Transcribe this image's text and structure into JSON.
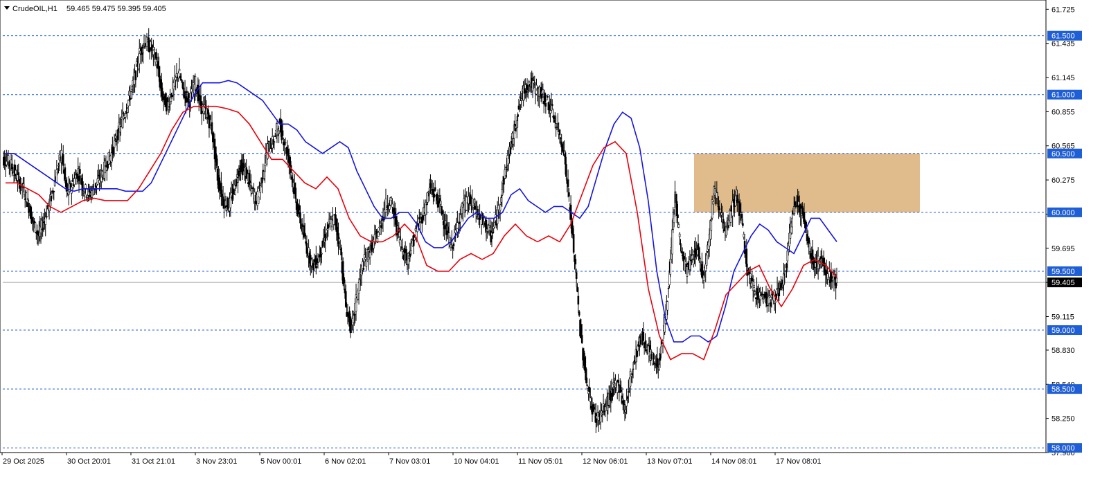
{
  "header": {
    "symbol": "CrudeOIL,H1",
    "ohlc": "59.465 59.475 59.395 59.405"
  },
  "colors": {
    "background": "#ffffff",
    "candle": "#000000",
    "level_line": "#1f5fd6",
    "level_label_bg": "#1f5fd6",
    "ma_fast": "#e8000b",
    "ma_slow": "#1414e0",
    "zone": "#deb887",
    "current_price_bg": "#000000",
    "current_price_line": "#a0a0a0"
  },
  "chart_data": {
    "type": "candlestick",
    "symbol": "CrudeOIL",
    "timeframe": "H1",
    "y_axis_ticks": [
      "61.725",
      "61.435",
      "61.145",
      "60.855",
      "60.565",
      "60.275",
      "59.985",
      "59.695",
      "59.405",
      "59.115",
      "58.830",
      "58.540",
      "58.250",
      "57.960"
    ],
    "ylim": [
      57.96,
      61.78
    ],
    "x_axis_labels": [
      "29 Oct 2025",
      "30 Oct 20:01",
      "31 Oct 21:01",
      "3 Nov 23:01",
      "5 Nov 00:01",
      "6 Nov 02:01",
      "7 Nov 03:01",
      "10 Nov 04:01",
      "11 Nov 05:01",
      "12 Nov 06:01",
      "13 Nov 07:01",
      "14 Nov 08:01",
      "17 Nov 08:01"
    ],
    "horizontal_levels": [
      "61.500",
      "61.000",
      "60.500",
      "60.000",
      "59.500",
      "59.000",
      "58.500",
      "58.000"
    ],
    "current_price": "59.405",
    "resistance_zone": {
      "low": 60.0,
      "high": 60.5,
      "from": "14 Nov 2025",
      "to": "17 Nov 2025"
    },
    "series": [
      {
        "type": "close",
        "values": [
          60.45,
          60.4,
          60.3,
          60.22,
          60.08,
          59.9,
          59.8,
          59.95,
          60.1,
          60.3,
          60.5,
          60.15,
          60.25,
          60.35,
          60.2,
          60.15,
          60.22,
          60.3,
          60.4,
          60.5,
          60.65,
          60.8,
          60.95,
          61.1,
          61.35,
          61.45,
          61.4,
          61.3,
          61.0,
          60.9,
          61.05,
          61.2,
          61.0,
          60.95,
          61.1,
          60.9,
          60.85,
          60.7,
          60.3,
          60.1,
          60.05,
          60.2,
          60.4,
          60.35,
          60.2,
          60.1,
          60.3,
          60.55,
          60.6,
          60.75,
          60.6,
          60.4,
          60.1,
          59.9,
          59.7,
          59.55,
          59.6,
          59.75,
          59.9,
          59.95,
          59.7,
          59.2,
          59.0,
          59.3,
          59.55,
          59.65,
          59.75,
          59.85,
          60.05,
          60.1,
          59.9,
          59.7,
          59.6,
          59.75,
          59.9,
          60.0,
          60.2,
          60.15,
          60.05,
          59.85,
          59.7,
          59.9,
          60.05,
          60.1,
          60.05,
          59.95,
          59.9,
          59.8,
          59.95,
          60.2,
          60.45,
          60.65,
          60.9,
          61.05,
          61.1,
          61.05,
          61.0,
          60.95,
          60.85,
          60.7,
          60.55,
          60.1,
          59.6,
          59.0,
          58.6,
          58.35,
          58.25,
          58.3,
          58.4,
          58.5,
          58.55,
          58.3,
          58.6,
          58.8,
          58.95,
          58.85,
          58.75,
          58.7,
          59.0,
          59.45,
          60.15,
          59.7,
          59.5,
          59.6,
          59.7,
          59.45,
          59.75,
          60.2,
          60.05,
          59.8,
          60.0,
          60.15,
          59.9,
          59.5,
          59.35,
          59.3,
          59.28,
          59.25,
          59.3,
          59.35,
          59.55,
          60.0,
          60.1,
          59.95,
          59.7,
          59.55,
          59.6,
          59.5,
          59.45,
          59.4
        ]
      },
      {
        "type": "moving_average",
        "color": "#1414e0",
        "values": [
          60.5,
          60.5,
          60.45,
          60.4,
          60.35,
          60.3,
          60.25,
          60.2,
          60.18,
          60.2,
          60.2,
          60.2,
          60.2,
          60.2,
          60.18,
          60.18,
          60.18,
          60.25,
          60.4,
          60.55,
          60.7,
          60.85,
          61.0,
          61.1,
          61.1,
          61.1,
          61.12,
          61.1,
          61.05,
          61.0,
          60.95,
          60.85,
          60.75,
          60.75,
          60.7,
          60.6,
          60.55,
          60.5,
          60.55,
          60.6,
          60.55,
          60.35,
          60.2,
          60.05,
          59.95,
          59.95,
          60.0,
          60.0,
          59.9,
          59.75,
          59.7,
          59.7,
          59.75,
          59.85,
          59.95,
          60.0,
          59.95,
          59.95,
          60.0,
          60.15,
          60.2,
          60.1,
          60.05,
          60.0,
          60.05,
          60.05,
          60.0,
          59.95,
          60.05,
          60.3,
          60.55,
          60.75,
          60.85,
          60.8,
          60.55,
          60.1,
          59.5,
          59.1,
          58.9,
          58.9,
          58.95,
          58.95,
          58.9,
          58.95,
          59.2,
          59.5,
          59.65,
          59.8,
          59.9,
          59.85,
          59.75,
          59.7,
          59.65,
          59.8,
          59.95,
          59.95,
          59.85,
          59.75
        ]
      },
      {
        "type": "moving_average",
        "color": "#e8000b",
        "values": [
          60.25,
          60.25,
          60.2,
          60.15,
          60.05,
          60.0,
          60.05,
          60.1,
          60.12,
          60.1,
          60.1,
          60.1,
          60.2,
          60.35,
          60.5,
          60.7,
          60.85,
          60.9,
          60.9,
          60.9,
          60.88,
          60.85,
          60.75,
          60.6,
          60.45,
          60.45,
          60.35,
          60.25,
          60.2,
          60.3,
          60.2,
          59.95,
          59.8,
          59.75,
          59.75,
          59.8,
          59.9,
          59.8,
          59.55,
          59.5,
          59.5,
          59.6,
          59.65,
          59.6,
          59.65,
          59.8,
          59.9,
          59.8,
          59.75,
          59.8,
          59.75,
          59.9,
          60.15,
          60.4,
          60.55,
          60.6,
          60.5,
          60.0,
          59.35,
          58.95,
          58.75,
          58.8,
          58.8,
          58.75,
          59.0,
          59.3,
          59.4,
          59.5,
          59.55,
          59.35,
          59.2,
          59.35,
          59.55,
          59.6,
          59.55,
          59.45
        ]
      }
    ]
  }
}
